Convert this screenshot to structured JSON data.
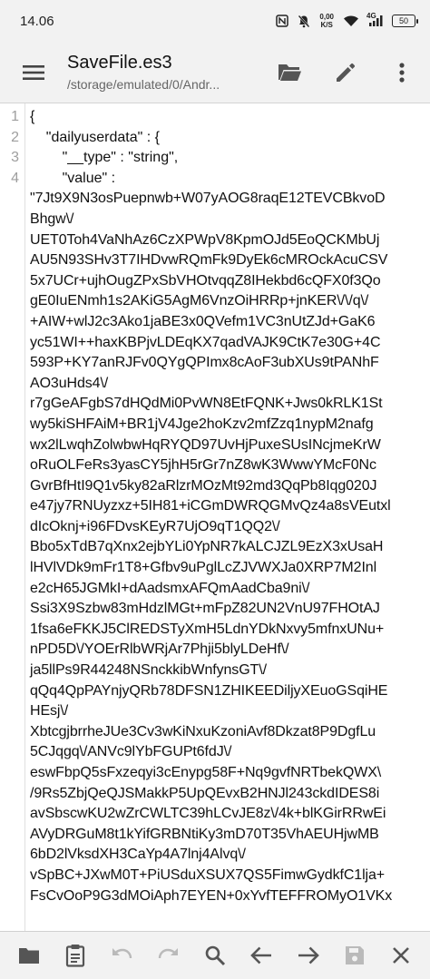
{
  "status_bar": {
    "time": "14.06",
    "net_speed_value": "0,00",
    "net_speed_unit": "K/S",
    "network_type": "4G",
    "battery": "50"
  },
  "app_bar": {
    "title": "SaveFile.es3",
    "subtitle": "/storage/emulated/0/Andr..."
  },
  "editor": {
    "line_numbers": [
      "1",
      "2",
      "3",
      "4"
    ],
    "lines": [
      "{",
      "    \"dailyuserdata\" : {",
      "        \"__type\" : \"string\",",
      "        \"value\" :"
    ],
    "value_lines": [
      "\"7Jt9X9N3osPuepnwb+W07yAOG8raqE12TEVCBkvoD",
      "Bhgw\\/",
      "UET0Toh4VaNhAz6CzXPWpV8KpmOJd5EoQCKMbUj",
      "AU5N93SHv3T7IHDvwRQmFk9DyEk6cMROckAcuCSV",
      "5x7UCr+ujhOugZPxSbVHOtvqqZ8IHekbd6cQFX0f3Qo",
      "gE0IuENmh1s2AKiG5AgM6VnzOiHRRp+jnKER\\/\\/q\\/",
      "+AIW+wlJ2c3Ako1jaBE3x0QVefm1VC3nUtZJd+GaK6",
      "yc51WI++haxKBPjvLDEqKX7qadVAJK9CtK7e30G+4C",
      "593P+KY7anRJFv0QYgQPImx8cAoF3ubXUs9tPANhF",
      "AO3uHds4\\/",
      "r7gGeAFgbS7dHQdMi0PvWN8EtFQNK+Jws0kRLK1St",
      "wy5kiSHFAiM+BR1jV4Jge2hoKzv2mfZzq1nypM2nafg",
      "wx2lLwqhZolwbwHqRYQD97UvHjPuxeSUsINcjmeKrW",
      "oRuOLFeRs3yasCY5jhH5rGr7nZ8wK3WwwYMcF0Nc",
      "GvrBfHtI9Q1v5ky82aRlzrMOzMt92md3QqPb8Iqg020J",
      "e47jy7RNUyzxz+5IH81+iCGmDWRQGMvQz4a8sVEutxl",
      "dIcOknj+i96FDvsKEyR7UjO9qT1QQ2\\/",
      "Bbo5xTdB7qXnx2ejbYLi0YpNR7kALCJZL9EzX3xUsaH",
      "lHVlVDk9mFr1T8+Gfbv9uPglLcZJVWXJa0XRP7M2Inl",
      "e2cH65JGMkI+dAadsmxAFQmAadCba9ni\\/",
      "Ssi3X9Szbw83mHdzlMGt+mFpZ82UN2VnU97FHOtAJ",
      "1fsa6eFKKJ5ClREDSTyXmH5LdnYDkNxvy5mfnxUNu+",
      "nPD5D\\/YOErRlbWRjAr7Phji5blyLDeHf\\/",
      "ja5llPs9R44248NSnckkibWnfynsGT\\/",
      "qQq4QpPAYnjyQRb78DFSN1ZHIKEEDiljyXEuoGSqiHE",
      "HEsj\\/",
      "XbtcgjbrrheJUe3Cv3wKiNxuKzoniAvf8Dkzat8P9DgfLu",
      "5CJqgq\\/ANVc9lYbFGUPt6fdJ\\/",
      "eswFbpQ5sFxzeqyi3cEnypg58F+Nq9gvfNRTbekQWX\\",
      "/9Rs5ZbjQeQJSMakkP5UpQEvxB2HNJl243ckdIDES8i",
      "avSbscwKU2wZrCWLTC39hLCvJE8z\\/4k+blKGirRRwEi",
      "AVyDRGuM8t1kYifGRBNtiKy3mD70T35VhAEUHjwMB",
      "6bD2lVksdXH3CaYp4A7lnj4Alvq\\/",
      "vSpBC+JXwM0T+PiUSduXSUX7QS5FimwGydkfC1lja+",
      "FsCvOoP9G3dMOiAph7EYEN+0xYvfTEFFROMyO1VKx"
    ]
  },
  "icons": {
    "menu": "hamburger-menu-icon",
    "folder": "folder-open-icon",
    "edit": "pencil-icon",
    "more": "more-vertical-icon",
    "bottom": [
      "folder-icon",
      "clipboard-icon",
      "undo-icon",
      "redo-icon",
      "search-icon",
      "arrow-left-icon",
      "arrow-right-icon",
      "save-icon",
      "close-icon"
    ]
  },
  "colors": {
    "bar_background": "#f2f2f2",
    "icon_color": "#555555",
    "line_number_color": "#9e9e9e"
  }
}
